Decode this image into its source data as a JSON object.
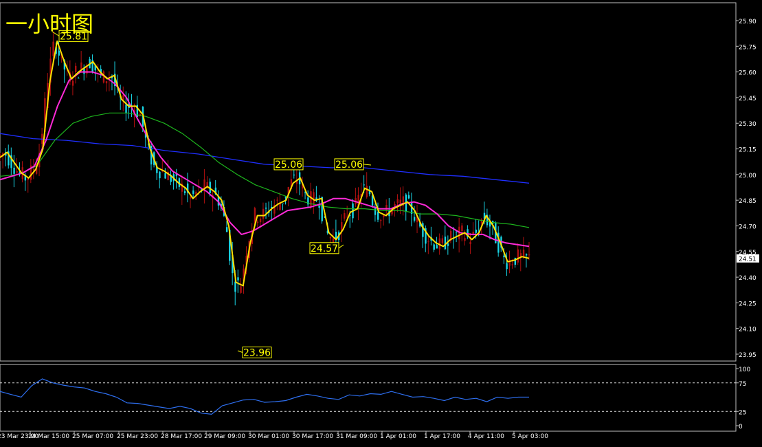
{
  "chart_title": "一小时图",
  "colors": {
    "background": "#000000",
    "frame": "#c0c0c0",
    "bull_candle": "#b01010",
    "bear_candle": "#19d6e6",
    "ma_fast": "#ffe000",
    "ma_mid": "#ff2ad8",
    "ma_slow": "#1db41d",
    "ma_long": "#1f2fff",
    "rsi_line": "#2e6ff0",
    "label_box": "#ffff00"
  },
  "price_axis": {
    "ticks": [
      "25.90",
      "25.75",
      "25.60",
      "25.45",
      "25.30",
      "25.15",
      "25.00",
      "24.85",
      "24.70",
      "24.55",
      "24.40",
      "24.25",
      "24.10",
      "23.95"
    ],
    "current_price": "24.51"
  },
  "indicator_axis": {
    "ticks": [
      "100",
      "75",
      "25",
      "0"
    ],
    "levels": [
      75,
      25
    ]
  },
  "time_axis": {
    "ticks": [
      "23 Mar 23:00",
      "24 Mar 15:00",
      "25 Mar 07:00",
      "25 Mar 23:00",
      "28 Mar 17:00",
      "29 Mar 09:00",
      "30 Mar 01:00",
      "30 Mar 17:00",
      "31 Mar 09:00",
      "1 Apr 01:00",
      "1 Apr 17:00",
      "4 Apr 11:00",
      "5 Apr 03:00"
    ]
  },
  "annotations": [
    {
      "text": "25.81",
      "price": 25.81
    },
    {
      "text": "25.06",
      "price": 25.06
    },
    {
      "text": "25.06",
      "price": 25.06
    },
    {
      "text": "24.57",
      "price": 24.57
    },
    {
      "text": "23.96",
      "price": 23.96
    }
  ],
  "chart_data": {
    "type": "line",
    "title": "一小时图",
    "ylim": [
      23.95,
      25.9
    ],
    "series": [
      {
        "name": "",
        "values": [
          25.1,
          25.13,
          25.07,
          25.01,
          24.98,
          25.03,
          25.15,
          25.55,
          25.78,
          25.66,
          25.56,
          25.6,
          25.63,
          25.66,
          25.6,
          25.56,
          25.58,
          25.44,
          25.4,
          25.4,
          25.35,
          25.15,
          25.04,
          25.02,
          24.99,
          24.95,
          24.92,
          24.86,
          24.9,
          24.93,
          24.9,
          24.85,
          24.7,
          24.37,
          24.35,
          24.6,
          24.76,
          24.76,
          24.8,
          24.83,
          24.85,
          24.95,
          24.98,
          24.88,
          24.85,
          24.86,
          24.66,
          24.62,
          24.68,
          24.78,
          24.8,
          24.92,
          24.9,
          24.78,
          24.76,
          24.8,
          24.82,
          24.84,
          24.79,
          24.7,
          24.64,
          24.6,
          24.58,
          24.62,
          24.64,
          24.66,
          24.62,
          24.66,
          24.76,
          24.7,
          24.6,
          24.49,
          24.5,
          24.52,
          24.51
        ]
      },
      {
        "name": "",
        "values": [
          24.97,
          24.99,
          25.01,
          25.05,
          25.2,
          25.4,
          25.55,
          25.6,
          25.6,
          25.58,
          25.53,
          25.45,
          25.32,
          25.2,
          25.1,
          25.02,
          24.98,
          24.94,
          24.9,
          24.84,
          24.72,
          24.65,
          24.67,
          24.71,
          24.75,
          24.79,
          24.8,
          24.81,
          24.83,
          24.86,
          24.86,
          24.84,
          24.82,
          24.8,
          24.8,
          24.83,
          24.84,
          24.82,
          24.77,
          24.7,
          24.66,
          24.65,
          24.65,
          24.62,
          24.6,
          24.59,
          24.58
        ]
      },
      {
        "name": "",
        "values": [
          24.99,
          25.0,
          25.05,
          25.2,
          25.3,
          25.34,
          25.36,
          25.36,
          25.34,
          25.3,
          25.24,
          25.16,
          25.07,
          25.0,
          24.94,
          24.9,
          24.86,
          24.83,
          24.81,
          24.8,
          24.8,
          24.79,
          24.79,
          24.77,
          24.77,
          24.76,
          24.74,
          24.72,
          24.71,
          24.69
        ]
      },
      {
        "name": "",
        "values": [
          25.24,
          25.21,
          25.2,
          25.18,
          25.17,
          25.14,
          25.12,
          25.09,
          25.06,
          25.05,
          25.04,
          25.04,
          25.02,
          25.0,
          24.99,
          24.97,
          24.95
        ]
      },
      {
        "name": "",
        "values": [
          60,
          55,
          50,
          70,
          82,
          75,
          71,
          68,
          66,
          60,
          56,
          50,
          40,
          39,
          36,
          33,
          30,
          34,
          30,
          22,
          20,
          35,
          40,
          45,
          46,
          41,
          42,
          44,
          50,
          55,
          52,
          48,
          46,
          54,
          52,
          56,
          55,
          60,
          55,
          50,
          51,
          48,
          44,
          50,
          46,
          48,
          42,
          50,
          48,
          50,
          50
        ]
      }
    ]
  }
}
